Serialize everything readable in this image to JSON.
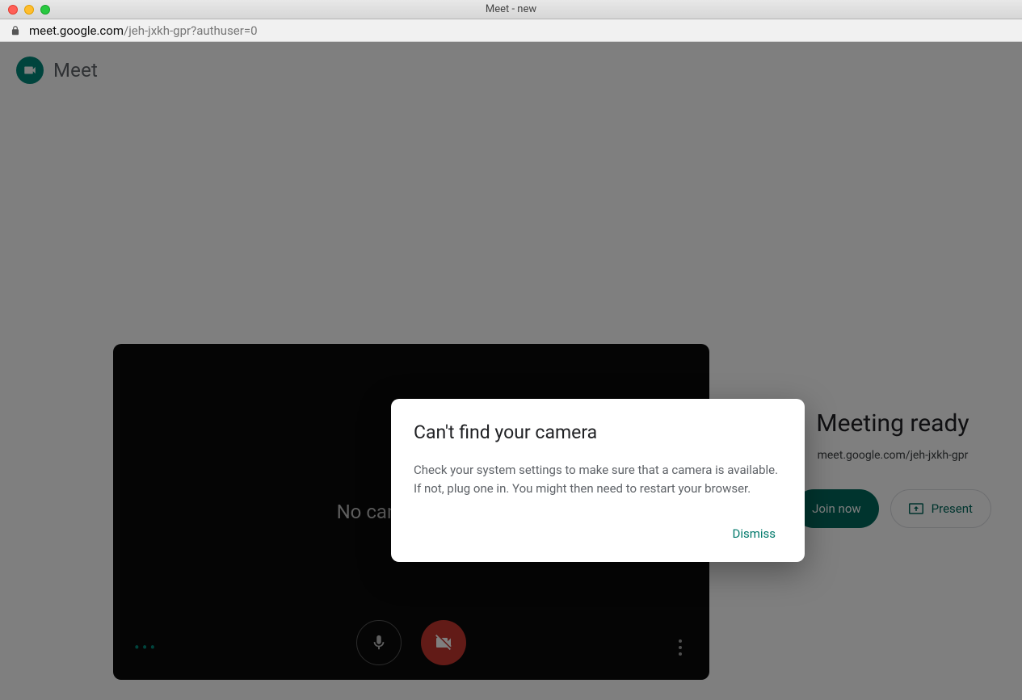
{
  "window": {
    "title": "Meet - new"
  },
  "addressbar": {
    "host": "meet.google.com",
    "path": "/jeh-jxkh-gpr?authuser=0"
  },
  "header": {
    "brand": "Meet"
  },
  "preview": {
    "no_camera_text": "No camera found"
  },
  "right": {
    "heading": "Meeting ready",
    "meeting_url": "meet.google.com/jeh-jxkh-gpr",
    "join_label": "Join now",
    "present_label": "Present"
  },
  "dialog": {
    "title": "Can't find your camera",
    "body": "Check your system settings to make sure that a camera is available. If not, plug one in. You might then need to restart your browser.",
    "dismiss_label": "Dismiss"
  }
}
